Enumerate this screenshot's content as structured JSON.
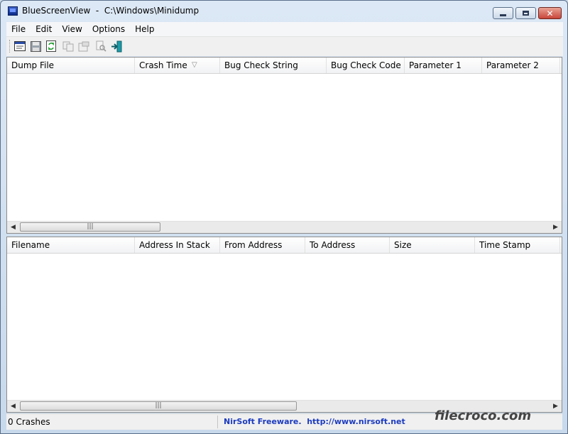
{
  "window": {
    "title": "BlueScreenView  -  C:\\Windows\\Minidump"
  },
  "menu": [
    "File",
    "Edit",
    "View",
    "Options",
    "Help"
  ],
  "toolbar": {
    "icons": [
      "properties-icon",
      "save-icon",
      "refresh-icon",
      "copy-icon",
      "html-report-icon",
      "find-icon",
      "exit-icon"
    ]
  },
  "top_table": {
    "columns": [
      "Dump File",
      "Crash Time",
      "Bug Check String",
      "Bug Check Code",
      "Parameter 1",
      "Parameter 2"
    ],
    "rows": []
  },
  "bottom_table": {
    "columns": [
      "Filename",
      "Address In Stack",
      "From Address",
      "To Address",
      "Size",
      "Time Stamp"
    ],
    "rows": []
  },
  "statusbar": {
    "count": "0 Crashes",
    "credit": "NirSoft Freeware.  http://www.nirsoft.net"
  },
  "watermark": "filecroco.com",
  "colors": {
    "credit": "#1c3bbf",
    "titlebar": "#dce8f5"
  }
}
